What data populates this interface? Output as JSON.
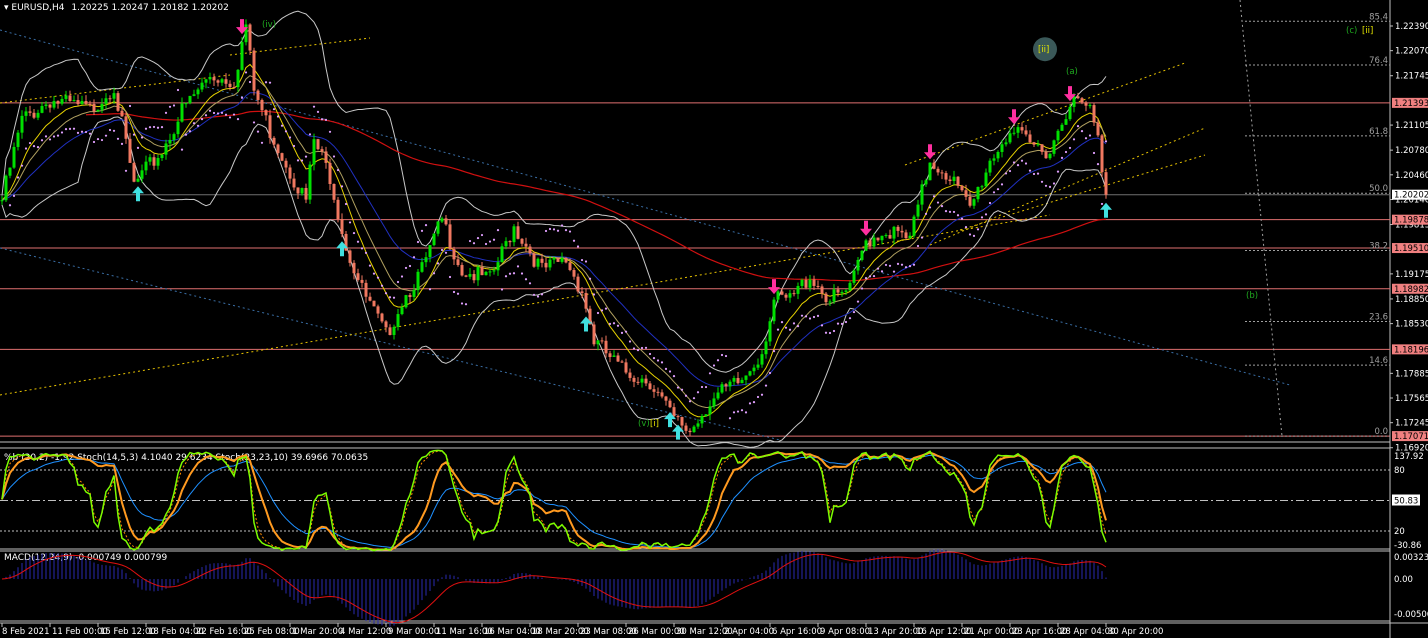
{
  "header": {
    "symbol": "EURUSD,H4",
    "ohlc": "1.20225 1.20247 1.20182 1.20202"
  },
  "oscillator_panel": {
    "legend": "%b (20,2) -1.92  Stoch(14,5,3) 4.1040 29.6234  Stoch(23,23,10) 39.6966 70.0635",
    "ticks": [
      "137.92",
      "80",
      "50.83",
      "20",
      "-30.86"
    ],
    "current": "50.83"
  },
  "macd_panel": {
    "legend": "MACD(12,24,9) -0.000749 0.000799",
    "ticks": [
      "0.003235",
      "0.00",
      "-0.005063"
    ]
  },
  "colors": {
    "bull": "#00e000",
    "bear": "#f07860",
    "level": "#e07070",
    "fib": "#a0a0a0",
    "trend_yellow": "#e6c200",
    "trend_blue": "#3a6ea5",
    "arrow_down": "#ff2fa0",
    "arrow_up": "#40e0e0",
    "wave_green": "#1faa1f",
    "wave_yellow": "#e6e600"
  },
  "chart_data": {
    "type": "candlestick",
    "title": "EURUSD,H4",
    "ylim": [
      1.1692,
      1.2255
    ],
    "price_ticks": [
      "1.22390",
      "1.22070",
      "1.21745",
      "1.21105",
      "1.20780",
      "1.20460",
      "1.20140",
      "1.19815",
      "1.19175",
      "1.18850",
      "1.18530",
      "1.17885",
      "1.17565",
      "1.17245",
      "1.16920"
    ],
    "levels": [
      {
        "price": 1.21393,
        "label": "1.21393"
      },
      {
        "price": 1.19878,
        "label": "1.19878"
      },
      {
        "price": 1.1951,
        "label": "1.19510"
      },
      {
        "price": 1.18982,
        "label": "1.18982"
      },
      {
        "price": 1.18196,
        "label": "1.18196"
      },
      {
        "price": 1.17071,
        "label": "1.17071"
      }
    ],
    "current_price": {
      "price": 1.20202,
      "label": "1.20202"
    },
    "fib": {
      "low": 1.17071,
      "high": 1.23371,
      "levels": [
        {
          "pct": 85.4,
          "label": "85.4"
        },
        {
          "pct": 76.4,
          "label": "76.4"
        },
        {
          "pct": 61.8,
          "label": "61.8"
        },
        {
          "pct": 50.0,
          "label": "50.0"
        },
        {
          "pct": 38.2,
          "label": "38.2"
        },
        {
          "pct": 23.6,
          "label": "23.6"
        },
        {
          "pct": 14.6,
          "label": "14.6"
        },
        {
          "pct": 0.0,
          "label": "0.0"
        }
      ]
    },
    "x_labels": [
      "8 Feb 2021",
      "11 Feb 00:00",
      "15 Feb 12:00",
      "18 Feb 04:00",
      "22 Feb 16:00",
      "25 Feb 08:00",
      "1 Mar 20:00",
      "4 Mar 12:00",
      "9 Mar 00:00",
      "11 Mar 16:00",
      "16 Mar 04:00",
      "18 Mar 20:00",
      "23 Mar 08:00",
      "26 Mar 00:00",
      "30 Mar 12:00",
      "2 Apr 04:00",
      "6 Apr 16:00",
      "9 Apr 08:00",
      "13 Apr 20:00",
      "16 Apr 12:00",
      "21 Apr 00:00",
      "23 Apr 16:00",
      "28 Apr 04:00",
      "30 Apr 20:00"
    ],
    "bars_per_label": 12,
    "price_path": [
      [
        0,
        1.2013
      ],
      [
        5,
        1.2117
      ],
      [
        12,
        1.2143
      ],
      [
        22,
        1.213
      ],
      [
        28,
        1.2162
      ],
      [
        33,
        1.2032
      ],
      [
        40,
        1.2077
      ],
      [
        45,
        1.2129
      ],
      [
        52,
        1.2175
      ],
      [
        58,
        1.2168
      ],
      [
        61,
        1.224
      ],
      [
        63,
        1.2155
      ],
      [
        67,
        1.2103
      ],
      [
        72,
        1.2051
      ],
      [
        76,
        1.2012
      ],
      [
        78,
        1.209
      ],
      [
        82,
        1.2045
      ],
      [
        86,
        1.1954
      ],
      [
        90,
        1.1896
      ],
      [
        96,
        1.1837
      ],
      [
        100,
        1.1883
      ],
      [
        105,
        1.1922
      ],
      [
        110,
        1.1987
      ],
      [
        115,
        1.1922
      ],
      [
        122,
        1.1909
      ],
      [
        128,
        1.198
      ],
      [
        135,
        1.1922
      ],
      [
        141,
        1.1935
      ],
      [
        145,
        1.1896
      ],
      [
        148,
        1.1831
      ],
      [
        155,
        1.1792
      ],
      [
        162,
        1.1779
      ],
      [
        168,
        1.1727
      ],
      [
        172,
        1.1714
      ],
      [
        177,
        1.1753
      ],
      [
        185,
        1.1779
      ],
      [
        190,
        1.1818
      ],
      [
        193,
        1.1883
      ],
      [
        197,
        1.1883
      ],
      [
        202,
        1.1916
      ],
      [
        207,
        1.1883
      ],
      [
        212,
        1.1896
      ],
      [
        216,
        1.1961
      ],
      [
        221,
        1.1974
      ],
      [
        227,
        1.1961
      ],
      [
        232,
        1.2065
      ],
      [
        237,
        1.2045
      ],
      [
        242,
        1.2
      ],
      [
        247,
        1.2065
      ],
      [
        252,
        1.2104
      ],
      [
        257,
        1.2084
      ],
      [
        262,
        1.2078
      ],
      [
        267,
        1.2143
      ],
      [
        272,
        1.213
      ],
      [
        274,
        1.2091
      ],
      [
        276,
        1.202
      ]
    ],
    "annotations": [
      {
        "text": "(iv)",
        "bar": 66,
        "price": 1.2238,
        "color": "green"
      },
      {
        "text": "[ii]",
        "bar": 260,
        "price": 1.2205,
        "color": "yellow",
        "circle": true
      },
      {
        "text": "(a)",
        "bar": 267,
        "price": 1.2177,
        "color": "green"
      },
      {
        "text": "(c)",
        "bar": 337,
        "price": 1.223,
        "color": "green"
      },
      {
        "text": "[ii]",
        "bar": 341,
        "price": 1.223,
        "color": "yellow"
      },
      {
        "text": "(b)",
        "bar": 312,
        "price": 1.1886,
        "color": "green"
      },
      {
        "text": "(v)",
        "bar": 160,
        "price": 1.172,
        "color": "green"
      },
      {
        "text": "[i]",
        "bar": 163,
        "price": 1.172,
        "color": "yellow"
      }
    ],
    "signals_down": [
      60,
      193,
      216,
      232,
      253,
      267
    ],
    "signals_up": [
      34,
      85,
      146,
      167,
      169,
      276
    ]
  }
}
